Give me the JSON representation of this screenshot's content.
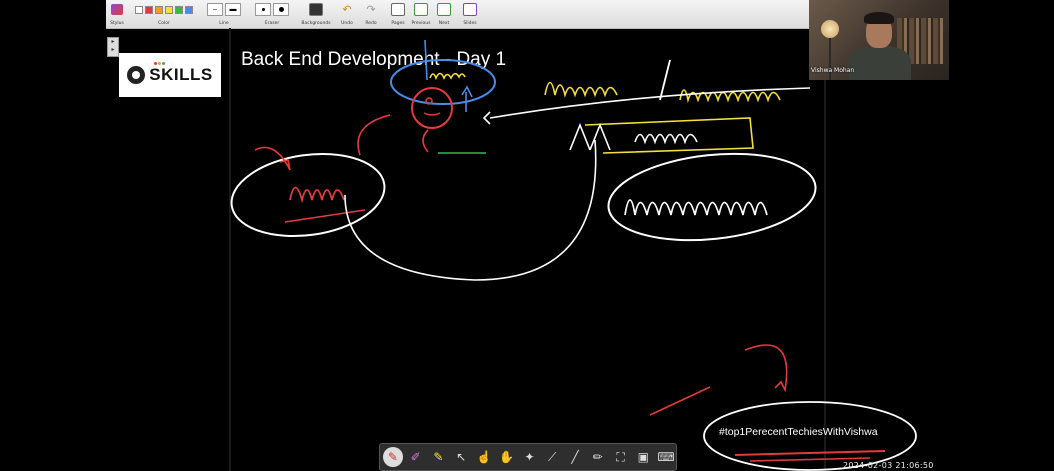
{
  "toolbar": {
    "groups": [
      {
        "label": "Stylus"
      },
      {
        "label": "Color"
      },
      {
        "label": "Line"
      },
      {
        "label": "Eraser"
      },
      {
        "label": "Backgrounds"
      },
      {
        "label": "Undo"
      },
      {
        "label": "Redo"
      },
      {
        "label": "Pages"
      },
      {
        "label": "Previous"
      },
      {
        "label": "Next"
      },
      {
        "label": "Slides"
      }
    ],
    "colors": [
      "#ffffff",
      "#e23b3b",
      "#f0a020",
      "#f4e03a",
      "#3fb24a",
      "#4a8de8"
    ]
  },
  "slide": {
    "logo_text": "SKILLS",
    "title": "Back End Development - Day 1",
    "logo_dot_colors": [
      "#e23b3b",
      "#f0a020",
      "#3fb24a"
    ]
  },
  "webcam": {
    "name": "Vishwa Mohan"
  },
  "board": {
    "hashtag": "#top1PerecentTechiesWithVishwa",
    "timestamp": "2024-02-03 21:06:50"
  },
  "bottom_tools": [
    {
      "icon": "pen-icon"
    },
    {
      "icon": "eraser-icon"
    },
    {
      "icon": "highlighter-icon"
    },
    {
      "icon": "pointer-icon"
    },
    {
      "icon": "hand-point-icon"
    },
    {
      "icon": "hand-icon"
    },
    {
      "icon": "magic-wand-icon"
    },
    {
      "icon": "laser-icon"
    },
    {
      "icon": "line-tool-icon"
    },
    {
      "icon": "pencil-icon"
    },
    {
      "icon": "shapes-icon"
    },
    {
      "icon": "screen-icon"
    },
    {
      "icon": "keyboard-icon"
    }
  ]
}
